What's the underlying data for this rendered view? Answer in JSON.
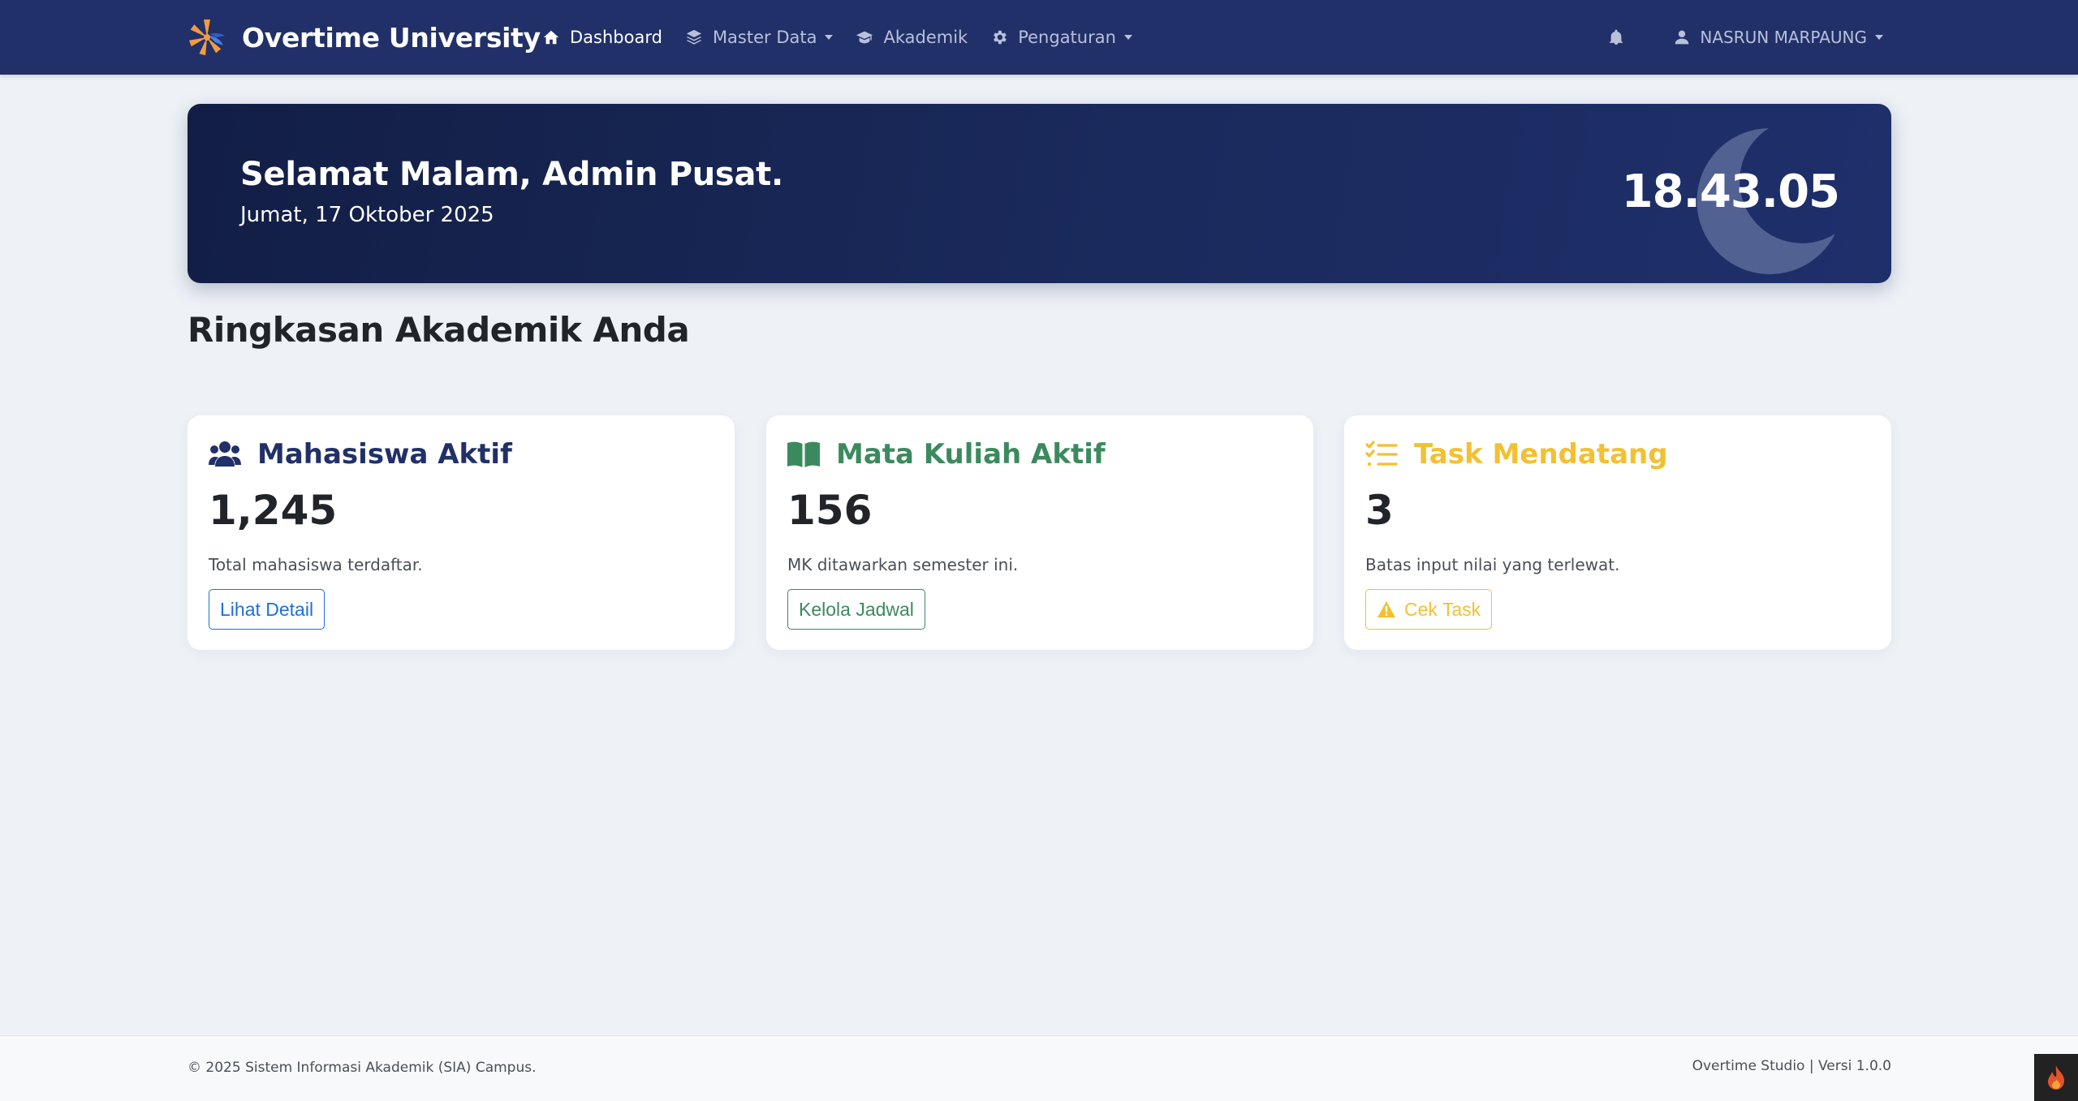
{
  "navbar": {
    "brand": "Overtime University",
    "items": [
      {
        "label": "Dashboard",
        "icon": "home-icon",
        "active": true
      },
      {
        "label": "Master Data",
        "icon": "layers-icon",
        "dropdown": true
      },
      {
        "label": "Akademik",
        "icon": "graduation-cap-icon"
      },
      {
        "label": "Pengaturan",
        "icon": "gear-icon",
        "dropdown": true
      }
    ],
    "user_name": "NASRUN MARPAUNG",
    "bar_color": "#213068"
  },
  "hero": {
    "greeting": "Selamat Malam, Admin Pusat.",
    "date": "Jumat, 17 Oktober 2025",
    "time": "18.43.05",
    "icon": "moon-icon"
  },
  "section_title": "Ringkasan Akademik Anda",
  "cards": [
    {
      "title": "Mahasiswa Aktif",
      "icon": "users-icon",
      "value": "1,245",
      "description": "Total mahasiswa terdaftar.",
      "button": "Lihat Detail",
      "color": "#213068",
      "button_color": "#1f6fdb"
    },
    {
      "title": "Mata Kuliah Aktif",
      "icon": "book-open-icon",
      "value": "156",
      "description": "MK ditawarkan semester ini.",
      "button": "Kelola Jadwal",
      "color": "#3b8a5e",
      "button_color": "#3b8a5e"
    },
    {
      "title": "Task Mendatang",
      "icon": "list-check-icon",
      "value": "3",
      "description": "Batas input nilai yang terlewat.",
      "button": "Cek Task",
      "button_icon": "warning-icon",
      "color": "#f2c032",
      "button_color": "#f2c032"
    }
  ],
  "footer": {
    "left": "© 2025 Sistem Informasi Akademik (SIA) Campus.",
    "right": "Overtime Studio | Versi 1.0.0"
  }
}
